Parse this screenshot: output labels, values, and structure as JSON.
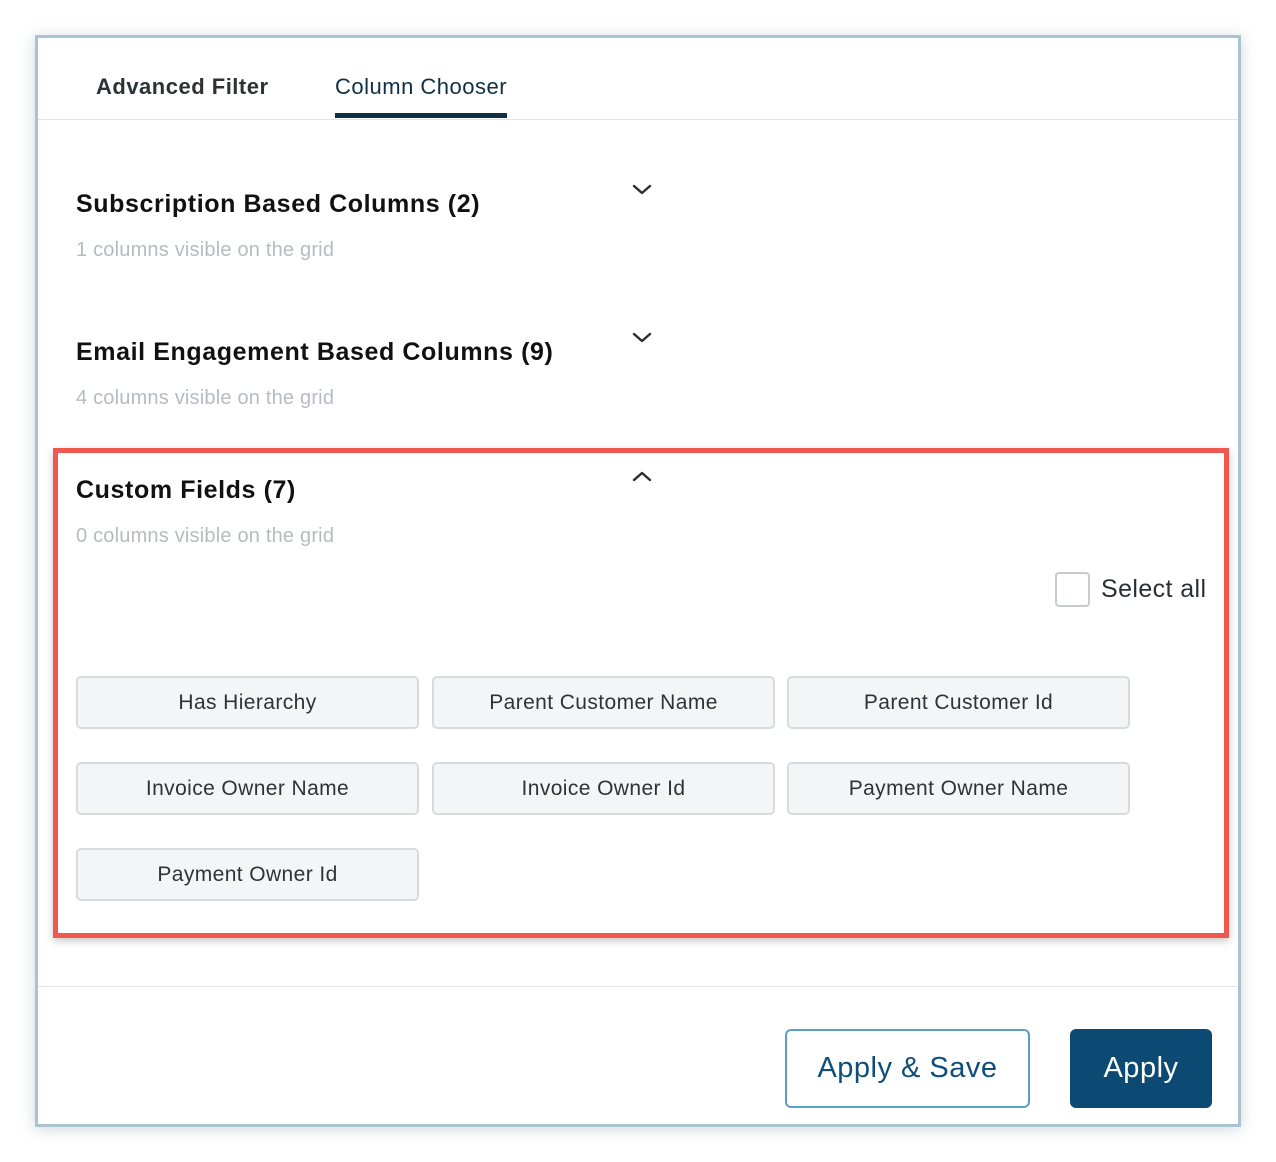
{
  "tabs": [
    {
      "label": "Advanced Filter",
      "active": false
    },
    {
      "label": "Column Chooser",
      "active": true
    }
  ],
  "sections": [
    {
      "title": "Subscription Based Columns (2)",
      "subtitle": "1 columns visible on the grid",
      "expanded": false,
      "icon": "chevron-down-icon"
    },
    {
      "title": "Email Engagement Based Columns (9)",
      "subtitle": "4 columns visible on the grid",
      "expanded": false,
      "icon": "chevron-down-icon"
    },
    {
      "title": "Custom Fields (7)",
      "subtitle": "0 columns visible on the grid",
      "expanded": true,
      "icon": "chevron-up-icon"
    }
  ],
  "custom_fields": {
    "select_all_label": "Select all",
    "select_all_checked": false,
    "chips": [
      "Has Hierarchy",
      "Parent Customer Name",
      "Parent Customer Id",
      "Invoice Owner Name",
      "Invoice Owner Id",
      "Payment Owner Name",
      "Payment Owner Id"
    ]
  },
  "footer": {
    "apply_save_label": "Apply & Save",
    "apply_label": "Apply"
  },
  "colors": {
    "accent": "#0c4a73",
    "highlight": "#f0584f"
  }
}
